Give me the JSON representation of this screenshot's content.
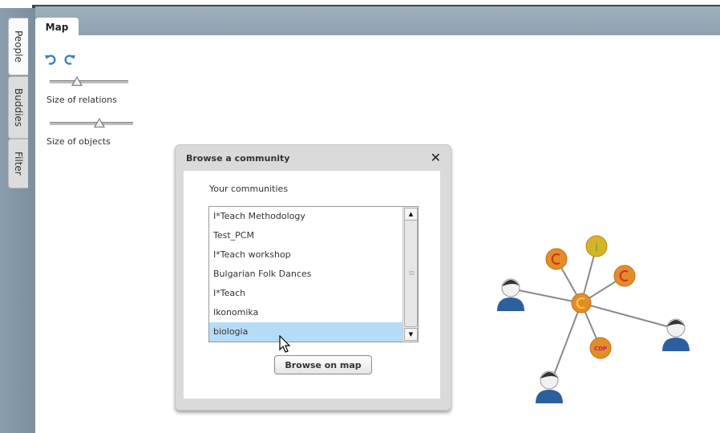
{
  "sidebar_tabs": [
    {
      "label": "People"
    },
    {
      "label": "Buddies"
    },
    {
      "label": "Filter"
    }
  ],
  "map_tab": {
    "label": "Map"
  },
  "controls": {
    "undo_icon": "undo-icon",
    "redo_icon": "redo-icon",
    "relations_label": "Size of relations",
    "relations_value": 0.35,
    "objects_label": "Size of objects",
    "objects_value": 0.6
  },
  "dialog": {
    "title": "Browse a community",
    "close_icon": "close-icon",
    "subtitle": "Your communities",
    "communities": [
      "I*Teach Methodology",
      "Test_PCM",
      "I*Teach workshop",
      "Bulgarian Folk Dances",
      "I*Teach",
      "Ikonomika",
      "biologia"
    ],
    "selected": "biologia",
    "browse_button": "Browse on map"
  },
  "graph": {
    "node_label": "CDP",
    "colors": {
      "node_orange": "#e48c28",
      "node_yellow": "#d4b32a",
      "user_blue": "#2d5f9e",
      "edge": "#8a8a8a"
    }
  }
}
